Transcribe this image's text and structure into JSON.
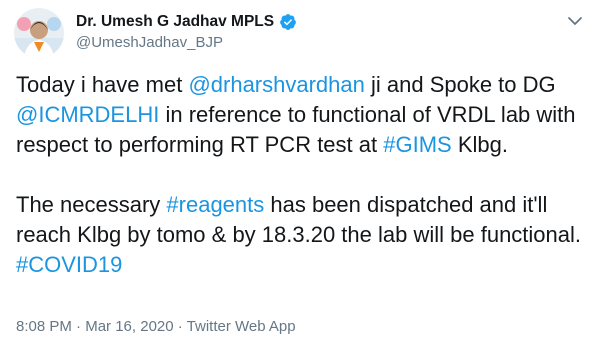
{
  "author": {
    "name": "Dr. Umesh G Jadhav MPLS",
    "handle": "@UmeshJadhav_BJP",
    "verified_icon": "verified-badge-icon",
    "avatar_icon": "profile-avatar"
  },
  "tweet": {
    "p1": {
      "t1": "Today i have met ",
      "m1": "@drharshvardhan",
      "t2": " ji and Spoke to DG ",
      "m2": "@ICMRDELHI",
      "t3": " in reference to functional of VRDL lab with respect to performing RT PCR test at ",
      "h1": "#GIMS",
      "t4": " Klbg."
    },
    "p2": {
      "t1": "The necessary ",
      "h1": "#reagents",
      "t2": " has been dispatched and it'll reach Klbg by tomo & by 18.3.20 the lab will be functional.",
      "h2": "#COVID19"
    }
  },
  "meta": {
    "time": "8:08 PM",
    "sep1": " · ",
    "date": "Mar 16, 2020",
    "sep2": " · ",
    "source": "Twitter Web App"
  },
  "colors": {
    "link": "#1b95e0",
    "text": "#14171a",
    "secondary": "#657786"
  }
}
